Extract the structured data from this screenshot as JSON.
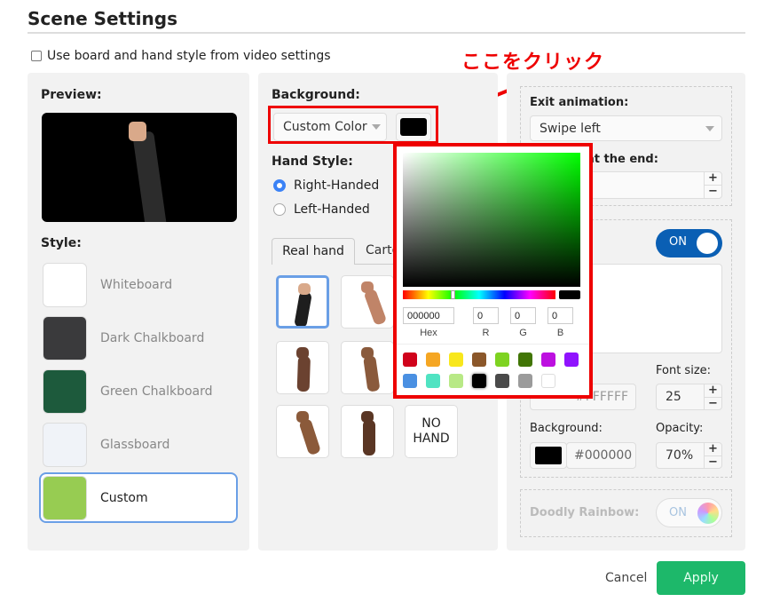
{
  "title": "Scene Settings",
  "checkbox_label": "Use board and hand style from video settings",
  "annotation": "ここをクリック",
  "left": {
    "preview_label": "Preview:",
    "style_label": "Style:",
    "styles": [
      {
        "name": "Whiteboard",
        "color": "#ffffff"
      },
      {
        "name": "Dark Chalkboard",
        "color": "#3a3a3c"
      },
      {
        "name": "Green Chalkboard",
        "color": "#1d5a3c"
      },
      {
        "name": "Glassboard",
        "color": "#f0f3f8"
      },
      {
        "name": "Custom",
        "color": "#97cc52",
        "selected": true
      }
    ]
  },
  "middle": {
    "background_label": "Background:",
    "background_select": "Custom Color",
    "background_color": "#000000",
    "hand_style_label": "Hand Style:",
    "hand_options": [
      {
        "label": "Right-Handed",
        "checked": true
      },
      {
        "label": "Left-Handed",
        "checked": false
      }
    ],
    "tabs": [
      {
        "label": "Real hand",
        "active": true
      },
      {
        "label": "Cartoon",
        "active": false
      }
    ],
    "no_hand": "NO HAND"
  },
  "picker": {
    "hex": "000000",
    "r": "0",
    "g": "0",
    "b": "0",
    "hex_label": "Hex",
    "r_label": "R",
    "g_label": "G",
    "b_label": "B",
    "hue_color": "#00ff00",
    "presets": [
      "#d0021b",
      "#f5a623",
      "#f8e71c",
      "#8b572a",
      "#7ed321",
      "#417505",
      "#bd10e0",
      "#9013fe",
      "#4a90e2",
      "#50e3c2",
      "#b8e986",
      "#000000",
      "#4a4a4a",
      "#9b9b9b",
      "#ffffff"
    ]
  },
  "right": {
    "exit_label": "Exit animation:",
    "exit_value": "Swipe left",
    "end_label": "at the end:",
    "toggle_on": "ON",
    "font_size_label": "Font size:",
    "font_size": "25",
    "text_color": "#FFFFFF",
    "bg_label": "Background:",
    "bg_value": "#000000",
    "opacity_label": "Opacity:",
    "opacity": "70%",
    "rainbow_label": "Doodly Rainbow:",
    "rainbow_toggle": "ON"
  },
  "footer": {
    "cancel": "Cancel",
    "apply": "Apply"
  },
  "colors": {
    "accent": "#0a5fb4",
    "apply": "#1db86a",
    "annotation": "#ee0000"
  }
}
